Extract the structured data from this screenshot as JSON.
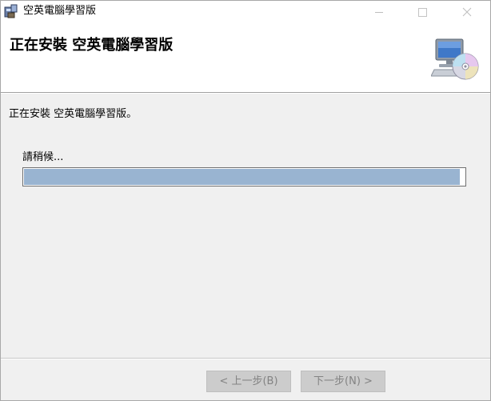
{
  "window": {
    "title": "空英電腦學習版",
    "controls": {
      "minimize": "minimize-icon",
      "maximize": "maximize-icon",
      "close": "close-icon"
    }
  },
  "banner": {
    "heading": "正在安裝 空英電腦學習版",
    "art_icon": "computer-disc-icon"
  },
  "body": {
    "status": "正在安裝 空英電腦學習版。",
    "wait_label": "請稍候...",
    "progress_fraction": 0.99
  },
  "footer": {
    "back_label": "< 上一步(B)",
    "next_label": "下一步(N) >"
  },
  "colors": {
    "progress_fill": "#99b4d1",
    "window_bg": "#f0f0f0",
    "button_disabled_bg": "#cccccc",
    "button_disabled_text": "#838383"
  }
}
